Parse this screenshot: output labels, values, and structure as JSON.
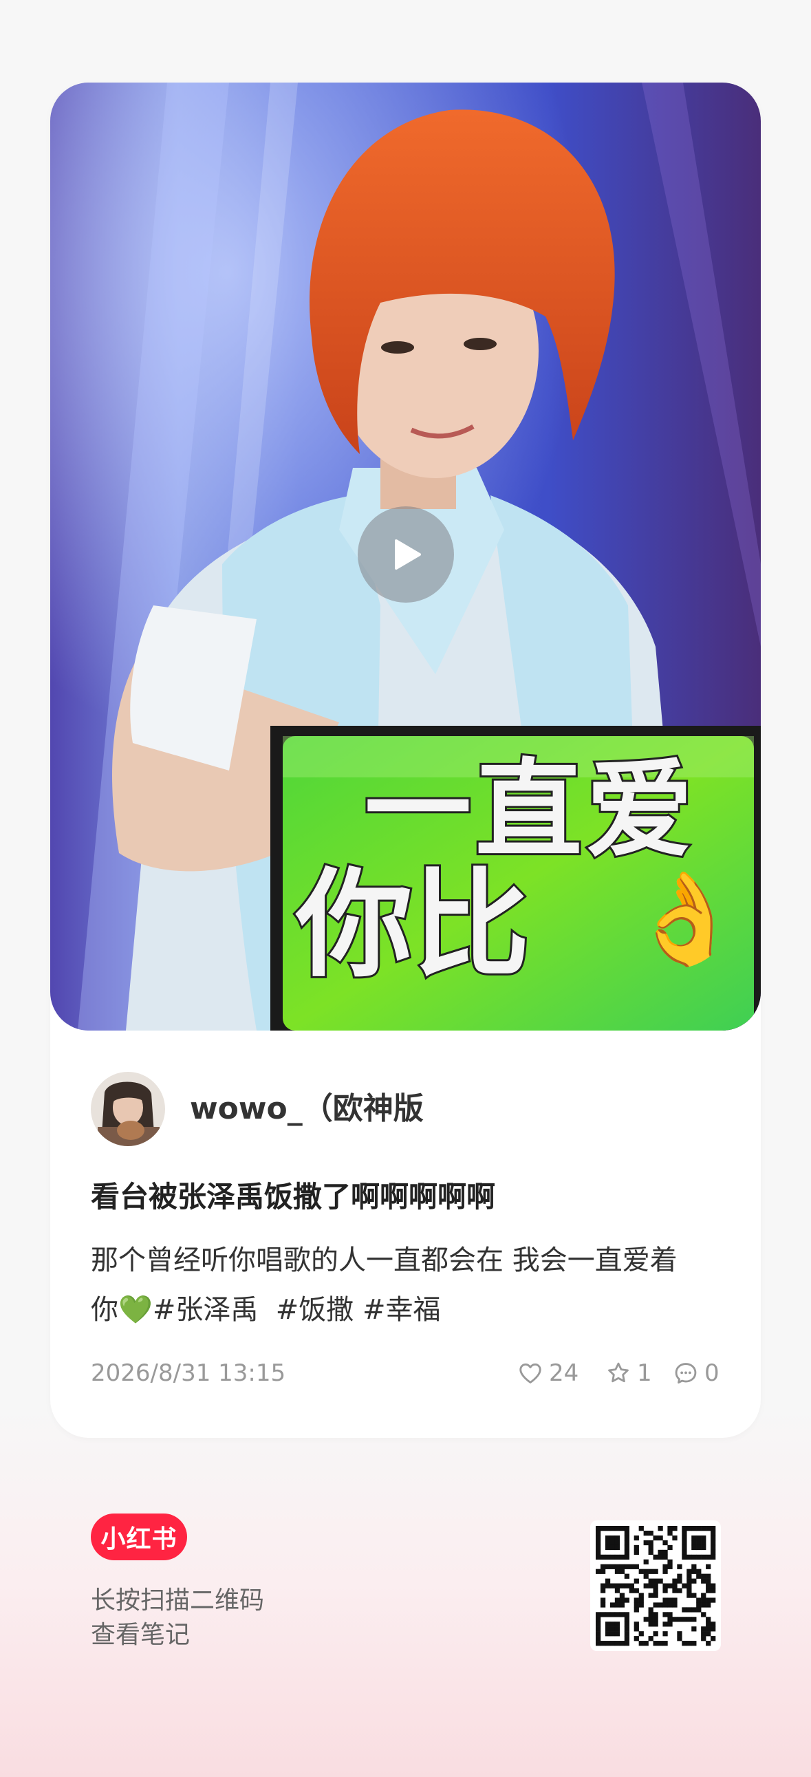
{
  "media": {
    "type": "video",
    "sign_line1": "一直爱",
    "sign_line2": "你比",
    "sign_emoji": "👌",
    "play_icon": "play-icon"
  },
  "author": {
    "name": "wowo_（欧神版"
  },
  "note": {
    "title": "看台被张泽禹饭撒了啊啊啊啊啊",
    "body_line1": "那个曾经听你唱歌的人一直都会在 我会一直爱着",
    "body_line2_prefix": "你",
    "heart_emoji": "💚",
    "tags": [
      "#张泽禹",
      "#饭撒",
      "#幸福"
    ],
    "date": "2026/8/31 13:15"
  },
  "stats": {
    "likes": "24",
    "collects": "1",
    "comments": "0",
    "like_icon": "heart-icon",
    "collect_icon": "star-icon",
    "comment_icon": "comment-icon"
  },
  "footer": {
    "brand": "小红书",
    "line1": "长按扫描二维码",
    "line2": "查看笔记"
  },
  "colors": {
    "brand_red": "#ff2442",
    "sign_green": "#6cdc2a",
    "hair_orange": "#e0501e",
    "stage_purple": "#5a4fb8"
  }
}
